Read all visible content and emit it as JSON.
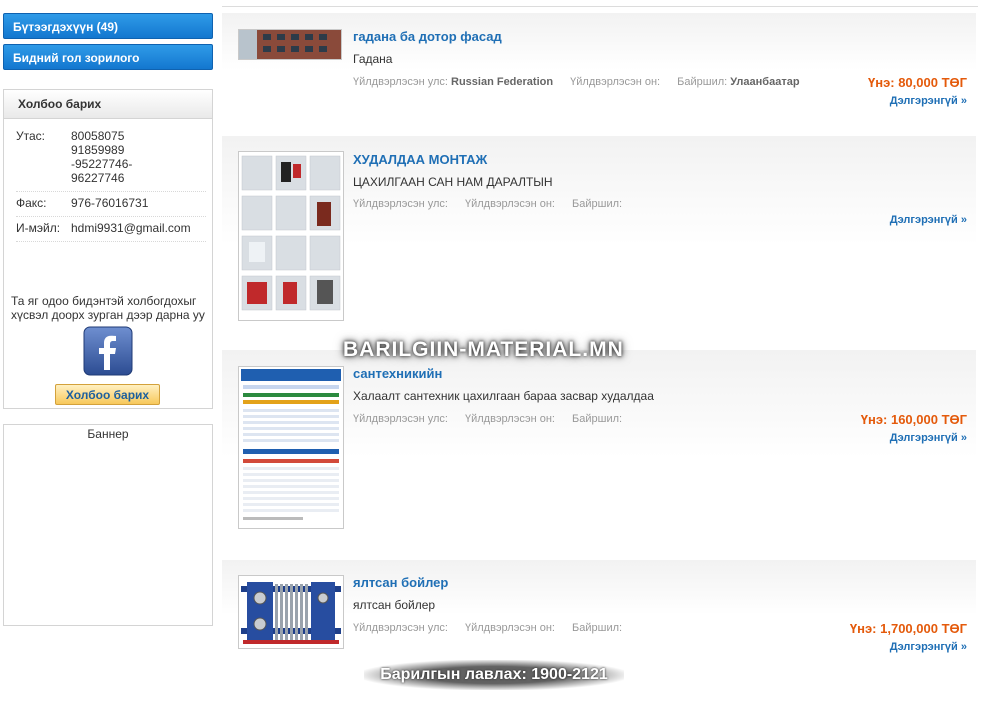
{
  "sidebar": {
    "nav": [
      {
        "label": "Бүтээгдэхүүн (49)"
      },
      {
        "label": "Бидний гол зорилого"
      }
    ],
    "contact": {
      "title": "Холбоо барих",
      "phone_label": "Утас:",
      "phone_lines": [
        "80058075",
        "91859989",
        "-95227746-",
        "96227746"
      ],
      "fax_label": "Факс:",
      "fax": "976-76016731",
      "email_label": "И-мэйл:",
      "email": "hdmi9931@gmail.com",
      "cta_text": "Та яг одоо бидэнтэй холбогдохыг хүсвэл доорх зурган дээр дарна уу",
      "facebook_icon": "facebook-icon",
      "button_label": "Холбоо барих"
    },
    "banner_label": "Баннер"
  },
  "meta_labels": {
    "country": "Үйлдвэрлэсэн улс:",
    "year": "Үйлдвэрлэсэн он:",
    "location": "Байршил:"
  },
  "listings": [
    {
      "title": "гадана ба дотор фасад",
      "desc": "Гадана",
      "country": "Russian Federation",
      "location": "Улаанбаатар",
      "price": "Үнэ: 80,000 ТӨГ",
      "more": "Дэлгэрэнгүй »"
    },
    {
      "title": "ХУДАЛДАА МОНТАЖ",
      "desc": "ЦАХИЛГААН САН НАМ ДАРАЛТЫН",
      "country": "",
      "location": "",
      "price": "",
      "more": "Дэлгэрэнгүй »"
    },
    {
      "title": "сантехникийн",
      "desc": "Халаалт сантехник цахилгаан бараа засвар худалдаа",
      "country": "",
      "location": "",
      "price": "Үнэ: 160,000 ТӨГ",
      "more": "Дэлгэрэнгүй »"
    },
    {
      "title": "ялтсан бойлер",
      "desc": "ялтсан бойлер",
      "country": "",
      "location": "",
      "price": "Үнэ: 1,700,000 ТӨГ",
      "more": "Дэлгэрэнгүй »"
    }
  ],
  "watermark": "BARILGIIN-MATERIAL.MN",
  "footer_stamp": "Барилгын лавлах: 1900-2121",
  "colors": {
    "link": "#1f6fb5",
    "price": "#e45a0b",
    "nav": "#1a86dc"
  }
}
